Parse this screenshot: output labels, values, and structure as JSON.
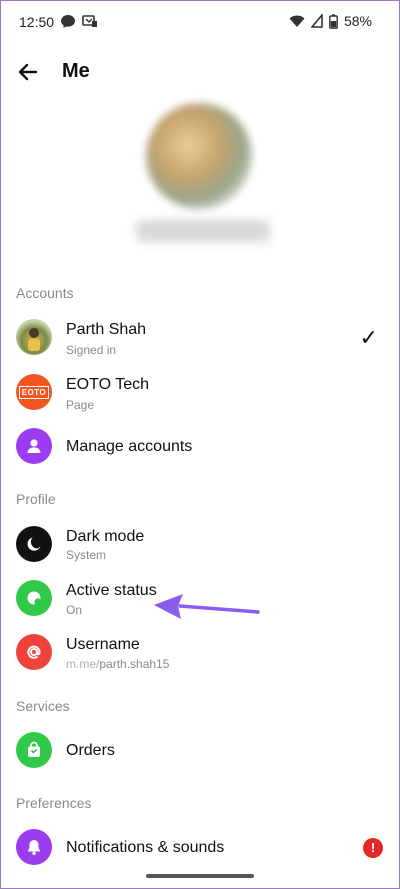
{
  "status_bar": {
    "time": "12:50",
    "battery": "58%",
    "icons": [
      "messenger-notification-icon",
      "hotspot-icon",
      "wifi-icon",
      "signal-icon",
      "battery-icon"
    ]
  },
  "header": {
    "title": "Me",
    "back_icon": "arrow-left-icon"
  },
  "sections": {
    "accounts": "Accounts",
    "profile": "Profile",
    "services": "Services",
    "preferences": "Preferences"
  },
  "accounts": {
    "parth": {
      "name": "Parth Shah",
      "sub": "Signed in",
      "selected_mark": "✓"
    },
    "eoto": {
      "name": "EOTO Tech",
      "sub": "Page",
      "logo_text": "EOTO"
    },
    "manage": {
      "label": "Manage accounts"
    }
  },
  "profile": {
    "dark_mode": {
      "label": "Dark mode",
      "sub": "System"
    },
    "active_status": {
      "label": "Active status",
      "sub": "On"
    },
    "username": {
      "label": "Username",
      "sub_prefix": "m.me/",
      "sub_value": "parth.shah15"
    }
  },
  "services": {
    "orders": {
      "label": "Orders"
    }
  },
  "preferences": {
    "notifications": {
      "label": "Notifications & sounds",
      "alert": "!"
    }
  },
  "colors": {
    "purple": "#9b3cf0",
    "black": "#111111",
    "green": "#31c94a",
    "red": "#f0423c",
    "eoto_orange": "#f2551f",
    "annotation_arrow": "#8a5cf0",
    "alert_red": "#e4282a"
  }
}
